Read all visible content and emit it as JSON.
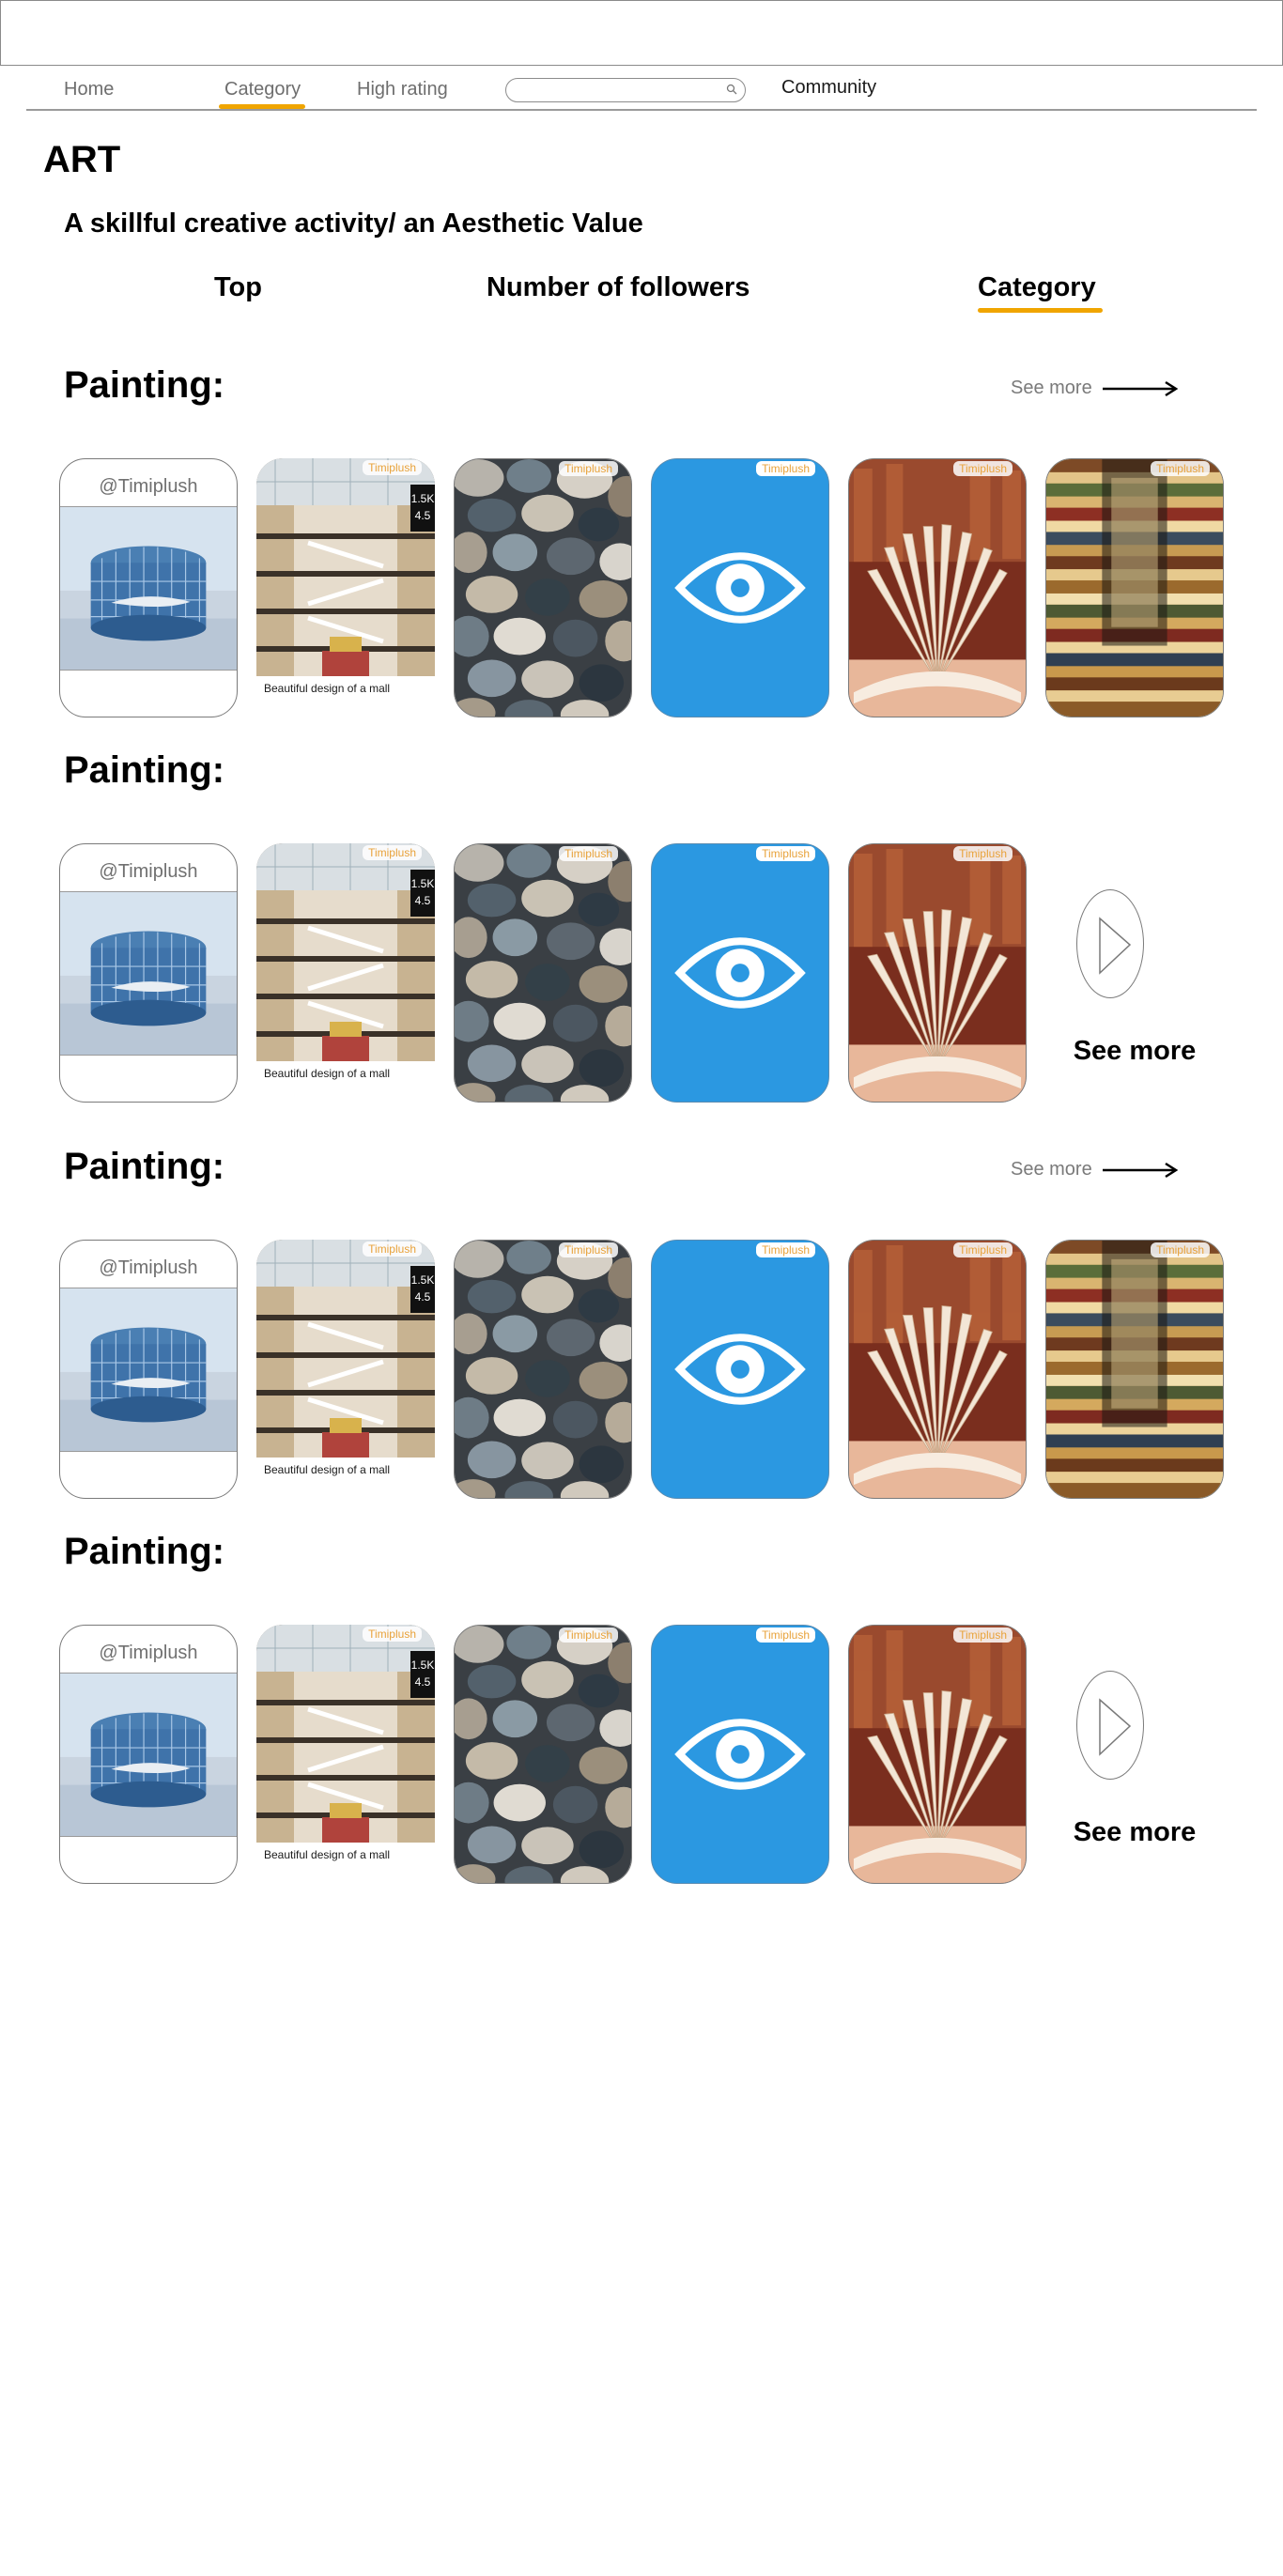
{
  "nav": {
    "items": [
      "Home",
      "Category",
      "High rating"
    ],
    "active": "Category",
    "search_placeholder": "",
    "community": "Community"
  },
  "page": {
    "title": "ART",
    "subtitle": "A skillful creative activity/ an Aesthetic Value"
  },
  "tabs": [
    "Top",
    "Number of followers",
    "Category"
  ],
  "active_tab": "Category",
  "sections": [
    {
      "title": "Painting:",
      "header_link": "See more"
    },
    {
      "title": "Painting:",
      "tail_label": "See more"
    },
    {
      "title": "Painting:",
      "header_link": "See more"
    },
    {
      "title": "Painting:",
      "tail_label": "See more"
    }
  ],
  "cards": {
    "profile_handle": "@Timiplush",
    "brand_tag": "Timiplush",
    "mall_caption": "Beautiful design of a mall",
    "mall_followers": "1.5K",
    "mall_rating": "4.5"
  },
  "colors": {
    "accent_underline": "#f0a500",
    "app_blue": "#2b98e1",
    "brand_tag": "#e8a23a"
  },
  "icons": [
    "search-icon",
    "arrow-right-icon",
    "eye-icon",
    "play-triangle-icon"
  ]
}
